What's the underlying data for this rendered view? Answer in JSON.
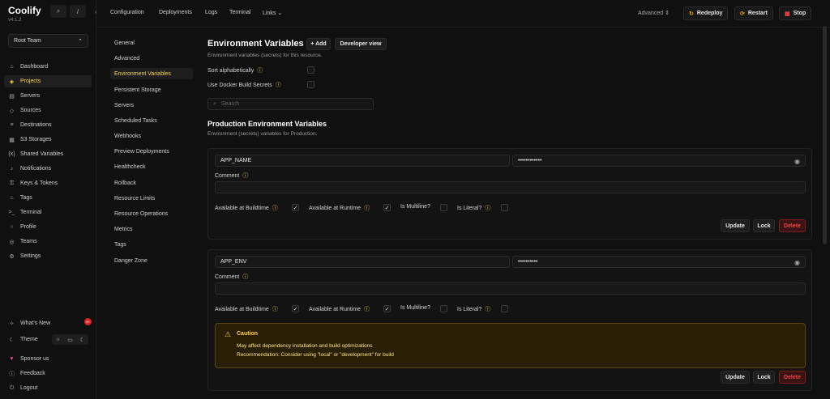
{
  "app": {
    "brand": "Coolify",
    "version": "v4.1.2"
  },
  "sidebar": {
    "team": "Root Team",
    "items": [
      {
        "label": "Dashboard",
        "icon": "home-icon"
      },
      {
        "label": "Projects",
        "icon": "layers-icon"
      },
      {
        "label": "Servers",
        "icon": "server-icon"
      },
      {
        "label": "Sources",
        "icon": "git-icon"
      },
      {
        "label": "Destinations",
        "icon": "database-icon"
      },
      {
        "label": "S3 Storages",
        "icon": "storage-icon"
      },
      {
        "label": "Shared Variables",
        "icon": "brackets-icon"
      },
      {
        "label": "Notifications",
        "icon": "bell-icon"
      },
      {
        "label": "Keys & Tokens",
        "icon": "key-icon"
      },
      {
        "label": "Tags",
        "icon": "tag-icon"
      },
      {
        "label": "Terminal",
        "icon": "terminal-icon"
      },
      {
        "label": "Profile",
        "icon": "user-icon"
      },
      {
        "label": "Teams",
        "icon": "users-icon"
      },
      {
        "label": "Settings",
        "icon": "gear-icon"
      }
    ],
    "bottom": {
      "whats_new": "What's New",
      "badge": "9+",
      "theme": "Theme",
      "sponsor": "Sponsor us",
      "feedback": "Feedback",
      "logout": "Logout"
    }
  },
  "topnav": {
    "configuration": "Configuration",
    "deployments": "Deployments",
    "logs": "Logs",
    "terminal": "Terminal",
    "links": "Links",
    "advanced": "Advanced",
    "redeploy": "Redeploy",
    "restart": "Restart",
    "stop": "Stop"
  },
  "submenu": [
    "General",
    "Advanced",
    "Environment Variables",
    "Persistent Storage",
    "Servers",
    "Scheduled Tasks",
    "Webhooks",
    "Preview Deployments",
    "Healthcheck",
    "Rollback",
    "Resource Limits",
    "Resource Operations",
    "Metrics",
    "Tags",
    "Danger Zone"
  ],
  "main": {
    "title": "Environment Variables",
    "add": "+ Add",
    "developer_view": "Developer view",
    "subtitle": "Environment variables (secrets) for this resource.",
    "sort": "Sort alphabetically",
    "docker_secrets": "Use Docker Build Secrets",
    "search_placeholder": "Search",
    "prod_title": "Production Environment Variables",
    "prod_subtitle": "Environment (secrets) variables for Production."
  },
  "vars": [
    {
      "name": "APP_NAME",
      "value": "••••••••••••",
      "comment_label": "Comment",
      "buildtime": "Available at Buildtime",
      "runtime": "Available at Runtime",
      "multiline": "Is Multiline?",
      "literal": "Is Literal?",
      "update": "Update",
      "lock": "Lock",
      "delete": "Delete"
    },
    {
      "name": "APP_ENV",
      "value": "••••••••••",
      "comment_label": "Comment",
      "buildtime": "Available at Buildtime",
      "runtime": "Available at Runtime",
      "multiline": "Is Multiline?",
      "literal": "Is Literal?",
      "update": "Update",
      "lock": "Lock",
      "delete": "Delete"
    }
  ],
  "caution": {
    "title": "Caution",
    "line1": "May affect dependency installation and build optimizations",
    "line2": "Recommendation: Consider using \"local\" or \"development\" for build"
  },
  "colors": {
    "accent": "#fcd34d",
    "danger": "#ef4444",
    "bg": "#101010"
  }
}
